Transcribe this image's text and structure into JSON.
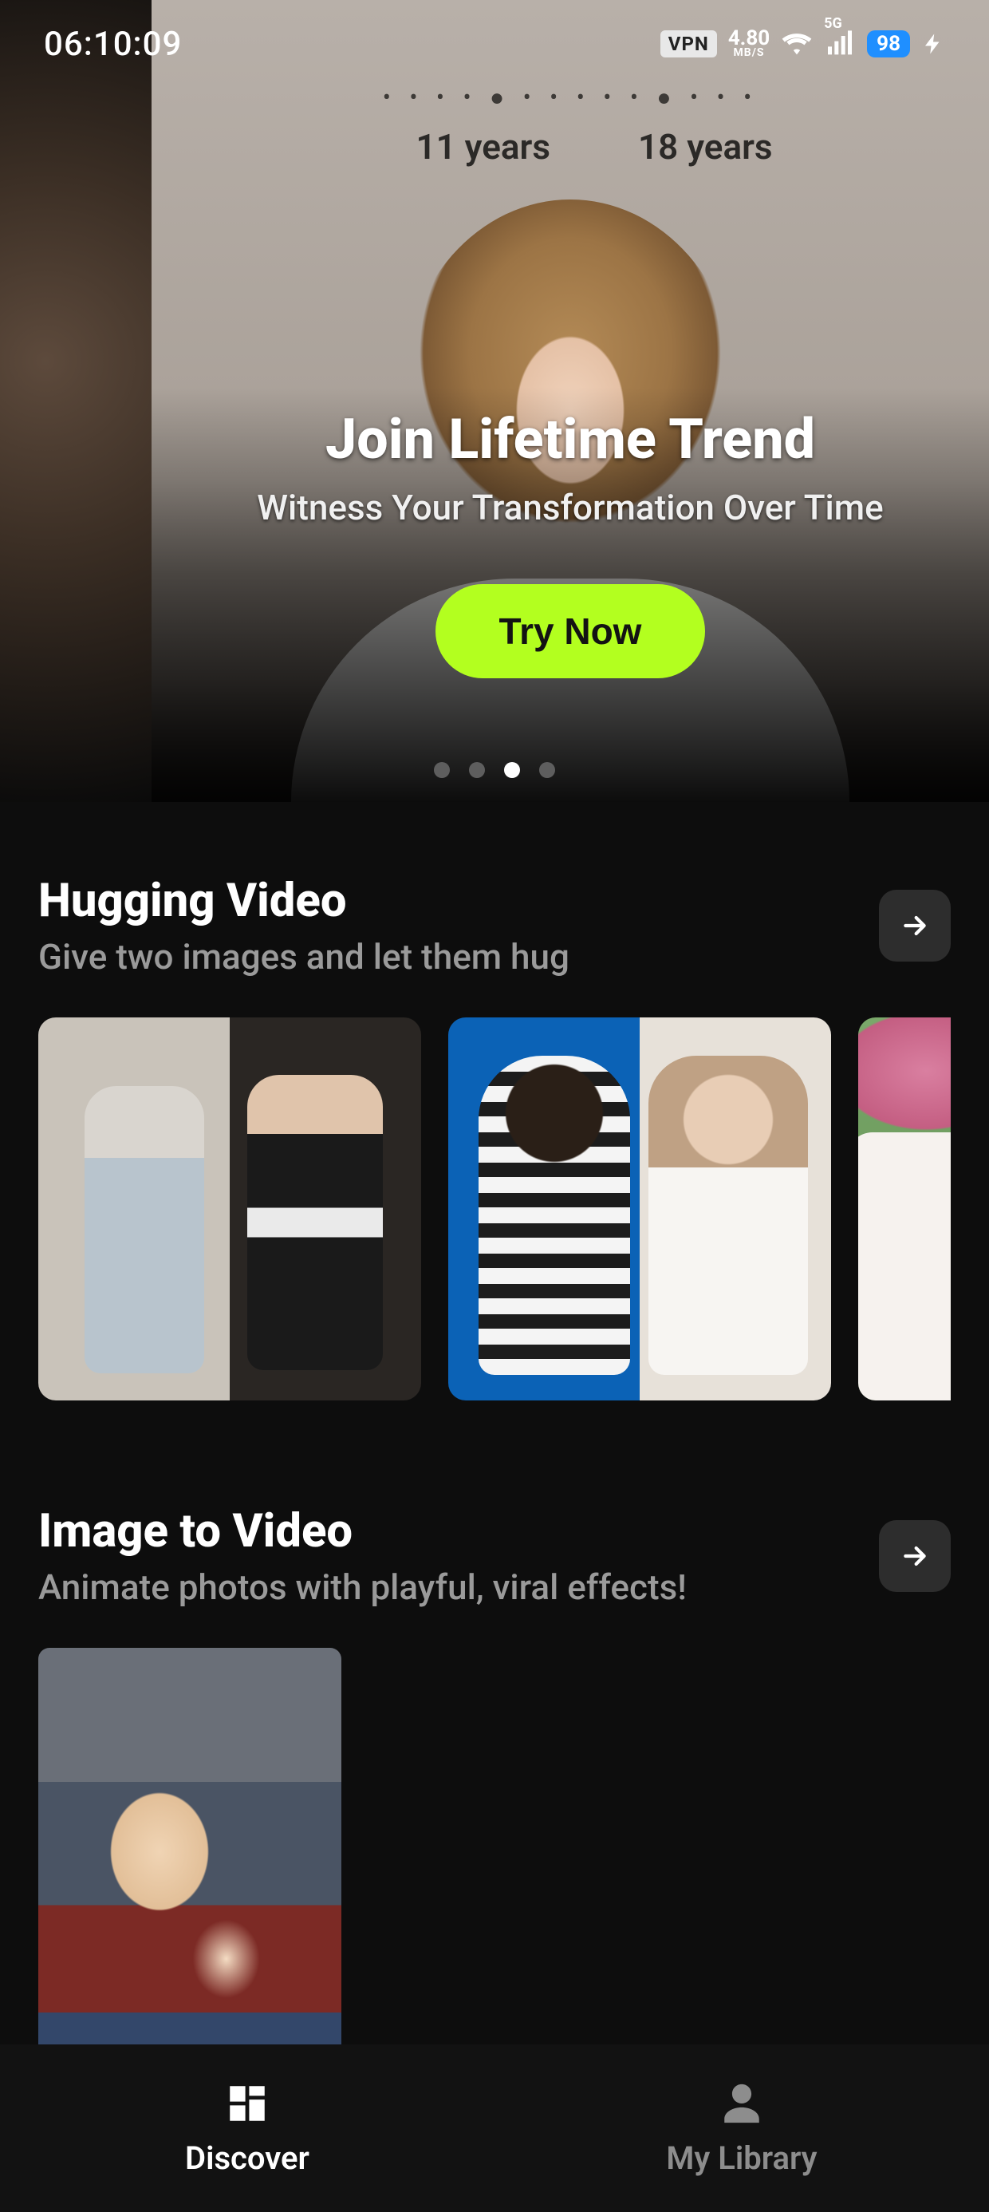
{
  "status_bar": {
    "time": "06:10:09",
    "vpn_label": "VPN",
    "net_speed_value": "4.80",
    "net_speed_unit": "MB/S",
    "signal_label": "5G",
    "battery_pct": "98"
  },
  "hero": {
    "age_labels": [
      "11 years",
      "18 years"
    ],
    "title": "Join Lifetime Trend",
    "subtitle": "Witness Your Transformation Over Time",
    "cta_label": "Try Now",
    "carousel": {
      "total": 4,
      "active_index": 2
    }
  },
  "sections": [
    {
      "id": "hugging",
      "title": "Hugging Video",
      "subtitle": "Give two images and let them hug",
      "thumbs": [
        "hug-sample-1",
        "hug-sample-2",
        "hug-sample-3"
      ]
    },
    {
      "id": "image_to_video",
      "title": "Image to Video",
      "subtitle": "Animate photos with playful, viral effects!",
      "thumbs": [
        "itv-sample-1"
      ]
    }
  ],
  "bottom_nav": {
    "items": [
      {
        "id": "discover",
        "label": "Discover",
        "active": true
      },
      {
        "id": "library",
        "label": "My Library",
        "active": false
      }
    ]
  },
  "colors": {
    "accent": "#b3ff1f",
    "battery": "#1f8fff"
  }
}
